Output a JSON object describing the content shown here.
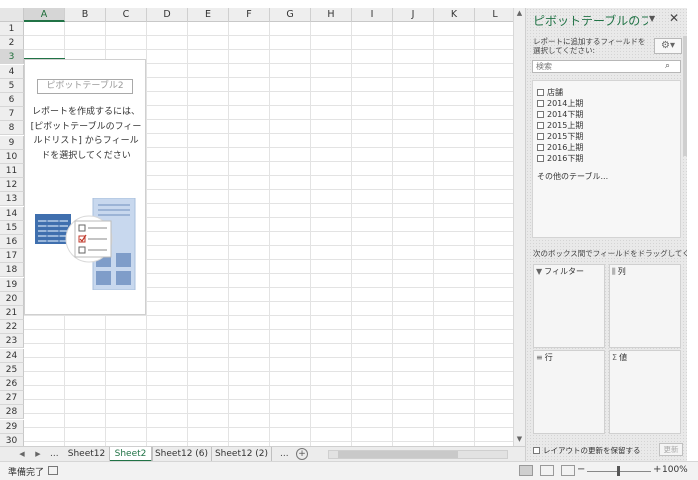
{
  "sheet": {
    "columns": [
      "A",
      "B",
      "C",
      "D",
      "E",
      "F",
      "G",
      "H",
      "I",
      "J",
      "K",
      "L"
    ],
    "rows": [
      "1",
      "2",
      "3",
      "4",
      "5",
      "6",
      "7",
      "8",
      "9",
      "10",
      "11",
      "12",
      "13",
      "14",
      "15",
      "16",
      "17",
      "18",
      "19",
      "20",
      "21",
      "22",
      "23",
      "24",
      "25",
      "26",
      "27",
      "28",
      "29",
      "30"
    ],
    "active_column": "A",
    "active_row": "3"
  },
  "pivot_placeholder": {
    "title": "ピボットテーブル2",
    "instructions": "レポートを作成するには、[ピボットテーブルのフィールドリスト] からフィールドを選択してください"
  },
  "tabs": {
    "more_left": "...",
    "items": [
      {
        "label": "Sheet12",
        "active": false
      },
      {
        "label": "Sheet2",
        "active": true
      },
      {
        "label": "Sheet12 (6)",
        "active": false
      },
      {
        "label": "Sheet12 (2)",
        "active": false
      }
    ],
    "more_right": "..."
  },
  "status": {
    "text": "準備完了",
    "zoom": "100%",
    "zoom_minus": "−",
    "zoom_plus": "+"
  },
  "pane": {
    "title": "ピボットテーブルのフィ...",
    "instruction": "レポートに追加するフィールドを選択してください:",
    "search_placeholder": "検索",
    "fields": [
      "店舗",
      "2014上期",
      "2014下期",
      "2015上期",
      "2015下期",
      "2016上期",
      "2016下期"
    ],
    "more_tables": "その他のテーブル...",
    "drag_instruction": "次のボックス間でフィールドをドラッグしてください:",
    "areas": {
      "filter": {
        "label": "フィルター",
        "icon": "filter-icon"
      },
      "columns": {
        "label": "列",
        "icon": "columns-icon"
      },
      "rows": {
        "label": "行",
        "icon": "rows-icon"
      },
      "values": {
        "label": "値",
        "icon": "sigma-icon"
      }
    },
    "defer_update_label": "レイアウトの更新を保留する",
    "update_button": "更新"
  }
}
